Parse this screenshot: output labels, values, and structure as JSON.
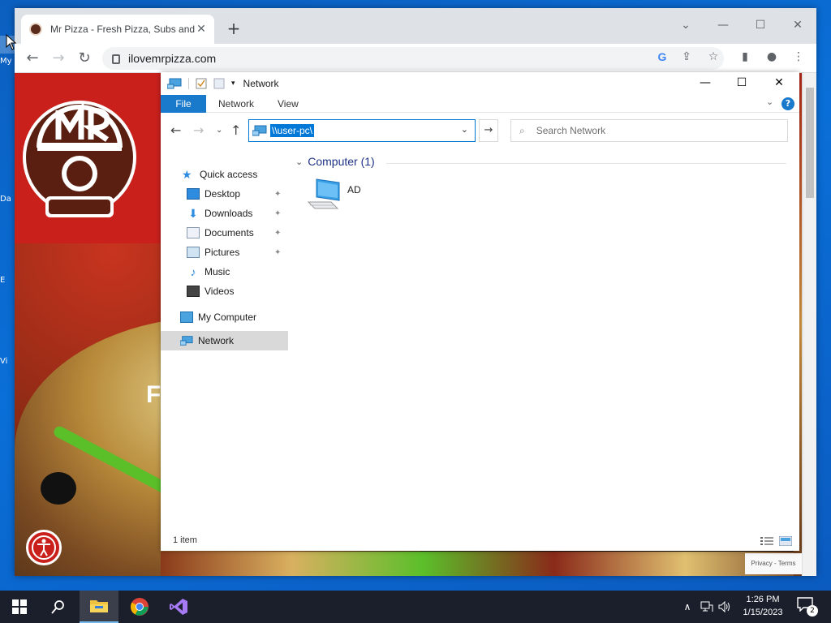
{
  "desktop": {
    "icons": [
      {
        "label": "My"
      },
      {
        "label": "Da"
      },
      {
        "label": "E"
      },
      {
        "label": "Vi"
      }
    ]
  },
  "browser": {
    "tab_title": "Mr Pizza - Fresh Pizza, Subs and",
    "url": "ilovemrpizza.com",
    "new_tab": "+",
    "site": {
      "partial_heading": "F",
      "recaptcha": "Privacy - Terms"
    }
  },
  "explorer": {
    "title": "Network",
    "ribbon": {
      "file": "File",
      "tabs": [
        "Network",
        "View"
      ],
      "help": "?"
    },
    "address": "\\\\user-pc\\",
    "search_placeholder": "Search Network",
    "nav": {
      "quick_access": "Quick access",
      "items": [
        "Desktop",
        "Downloads",
        "Documents",
        "Pictures",
        "Music",
        "Videos"
      ],
      "my_computer": "My Computer",
      "network": "Network"
    },
    "group_label": "Computer (1)",
    "computer_name": "AD",
    "status": "1 item"
  },
  "taskbar": {
    "time": "1:26 PM",
    "date": "1/15/2023",
    "notifications": "2"
  },
  "colors": {
    "accent": "#0078d7",
    "file_tab": "#1979ca",
    "taskbar": "#1a1f2b",
    "brand_red": "#c9201c"
  }
}
